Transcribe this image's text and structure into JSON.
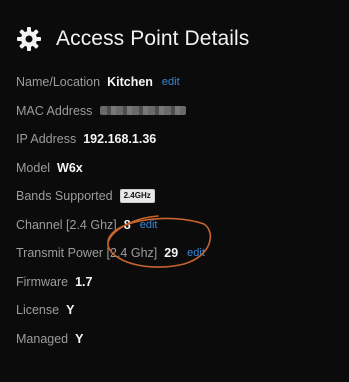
{
  "header": {
    "title": "Access Point Details",
    "icon": "gear-icon"
  },
  "details": {
    "name_location": {
      "label": "Name/Location",
      "value": "Kitchen",
      "edit": "edit"
    },
    "mac_address": {
      "label": "MAC Address"
    },
    "ip_address": {
      "label": "IP Address",
      "value": "192.168.1.36"
    },
    "model": {
      "label": "Model",
      "value": "W6x"
    },
    "bands_supported": {
      "label": "Bands Supported",
      "value": "2.4GHz"
    },
    "channel": {
      "label": "Channel [2.4 Ghz]",
      "value": "8",
      "edit": "edit"
    },
    "transmit_power": {
      "label": "Transmit Power [2.4 Ghz]",
      "value": "29",
      "edit": "edit"
    },
    "firmware": {
      "label": "Firmware",
      "value": "1.7"
    },
    "license": {
      "label": "License",
      "value": "Y"
    },
    "managed": {
      "label": "Managed",
      "value": "Y"
    }
  },
  "colors": {
    "background": "#0b0b0b",
    "edit_link": "#3a86d6",
    "annotation": "#c8652e"
  }
}
